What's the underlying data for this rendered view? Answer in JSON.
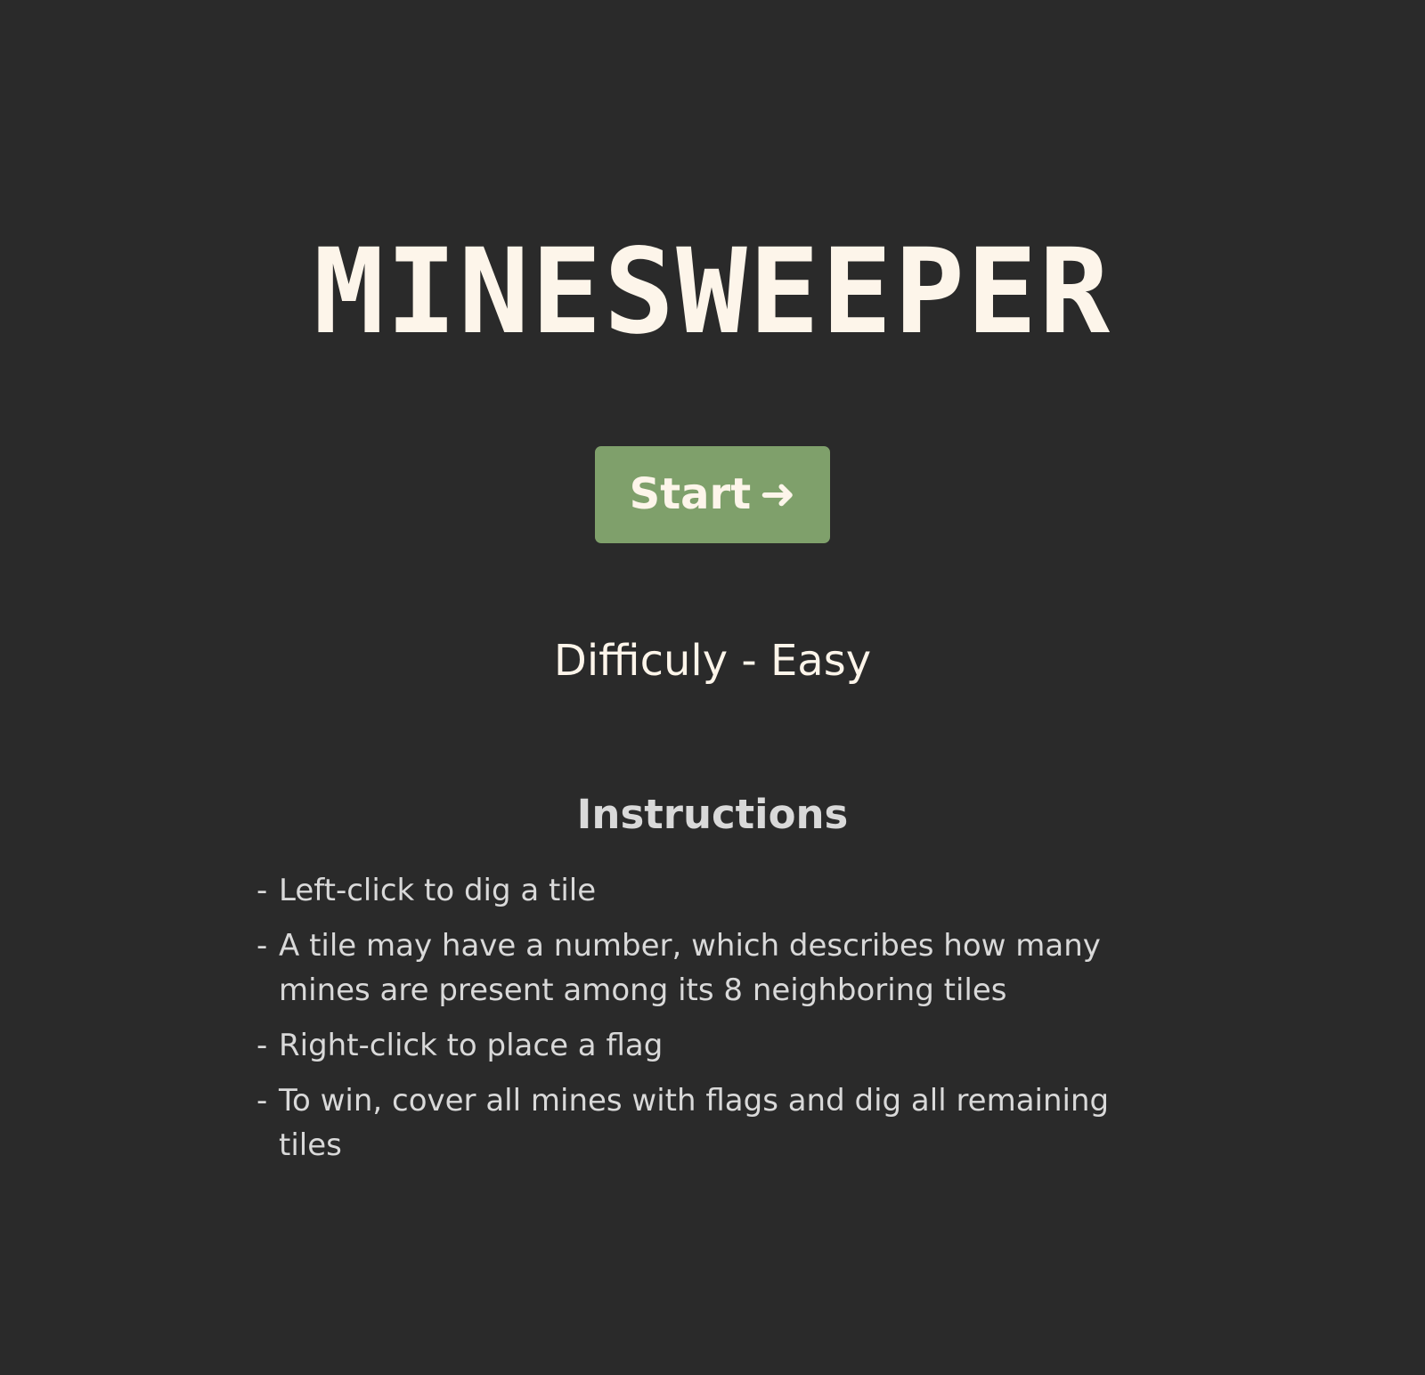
{
  "title": "MINESWEEPER",
  "start_button": {
    "label": "Start",
    "icon": "arrow-right-icon",
    "arrow_glyph": "➜",
    "color": "#7fa06b"
  },
  "difficulty": {
    "label": "Difficuly - Easy"
  },
  "instructions": {
    "heading": "Instructions",
    "items": [
      "Left-click to dig a tile",
      "A tile may have a number, which describes how many mines are present among its 8 neighboring tiles",
      "Right-click to place a flag",
      "To win, cover all mines with flags and dig all remaining tiles"
    ]
  },
  "colors": {
    "background": "#2a2a2a",
    "text_primary": "#fdf5ea",
    "text_secondary": "#d9d9d9"
  }
}
